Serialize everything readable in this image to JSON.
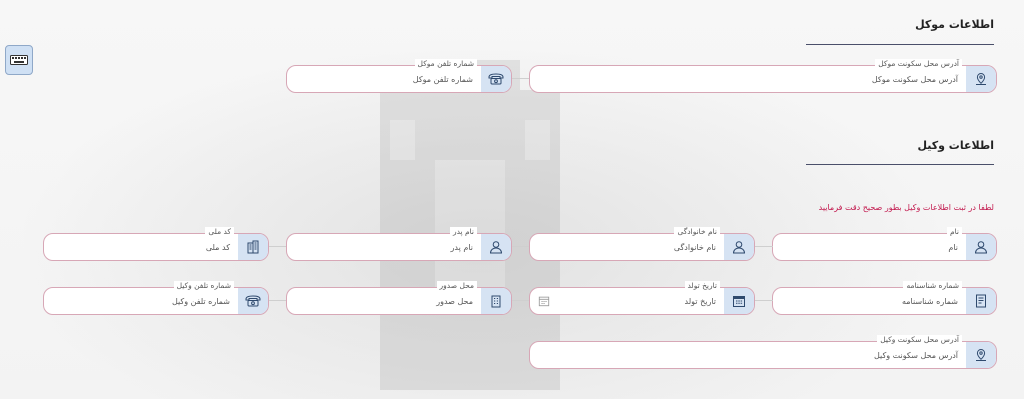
{
  "client_section": {
    "title": "اطلاعات موکل",
    "fields": [
      {
        "label": "آدرس محل سکونت موکل",
        "value": "آدرس محل سکونت موکل",
        "icon": "map-pin-icon"
      },
      {
        "label": "شماره تلفن موکل",
        "value": "شماره تلفن موکل",
        "icon": "phone-icon"
      }
    ]
  },
  "lawyer_section": {
    "title": "اطلاعات وکیل",
    "notice": "لطفا در ثبت اطلاعات وکیل بطور صحیح دقت فرمایید",
    "row1": [
      {
        "label": "نام",
        "value": "نام",
        "icon": "user-icon"
      },
      {
        "label": "نام خانوادگی",
        "value": "نام خانوادگی",
        "icon": "user-icon"
      },
      {
        "label": "نام پدر",
        "value": "نام پدر",
        "icon": "user-icon"
      },
      {
        "label": "کد ملی",
        "value": "کد ملی",
        "icon": "building-icon"
      }
    ],
    "row2": [
      {
        "label": "شماره شناسنامه",
        "value": "شماره شناسنامه",
        "icon": "document-icon"
      },
      {
        "label": "تاریخ تولد",
        "value": "تاریخ تولد",
        "icon": "calendar-icon"
      },
      {
        "label": "محل صدور",
        "value": "محل صدور",
        "icon": "building-icon"
      },
      {
        "label": "شماره تلفن وکیل",
        "value": "شماره تلفن وکیل",
        "icon": "phone-icon"
      }
    ],
    "row3": [
      {
        "label": "آدرس محل سکونت وکیل",
        "value": "آدرس محل سکونت وکیل",
        "icon": "map-pin-icon"
      }
    ]
  },
  "colors": {
    "field_border": "#d7a7b6",
    "icon_bg": "#d6e3f3",
    "notice": "#c2184d",
    "section_line": "#4a4f6a"
  }
}
